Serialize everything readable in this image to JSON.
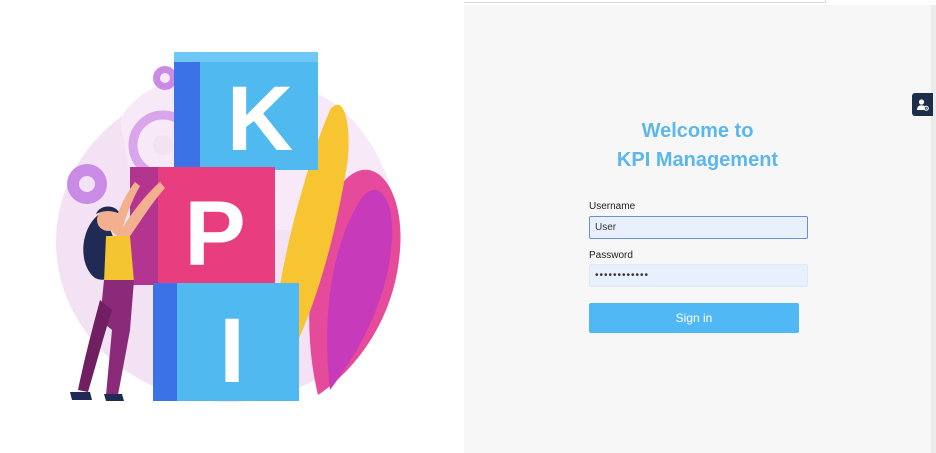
{
  "login": {
    "title_line1": "Welcome to",
    "title_line2": "KPI Management",
    "username_label": "Username",
    "username_value": "User",
    "password_label": "Password",
    "password_value": "Password1234",
    "signin_label": "Sign in"
  },
  "illustration": {
    "letters": [
      "K",
      "P",
      "I"
    ],
    "icon": "kpi-illustration"
  },
  "side_tab": {
    "icon": "user-settings-icon"
  },
  "colors": {
    "accent": "#50b8f5",
    "title": "#5bb7ec",
    "right_bg": "#f7f7f7",
    "input_bg": "#e8f0fe",
    "tab_bg": "#1c2f4a"
  }
}
